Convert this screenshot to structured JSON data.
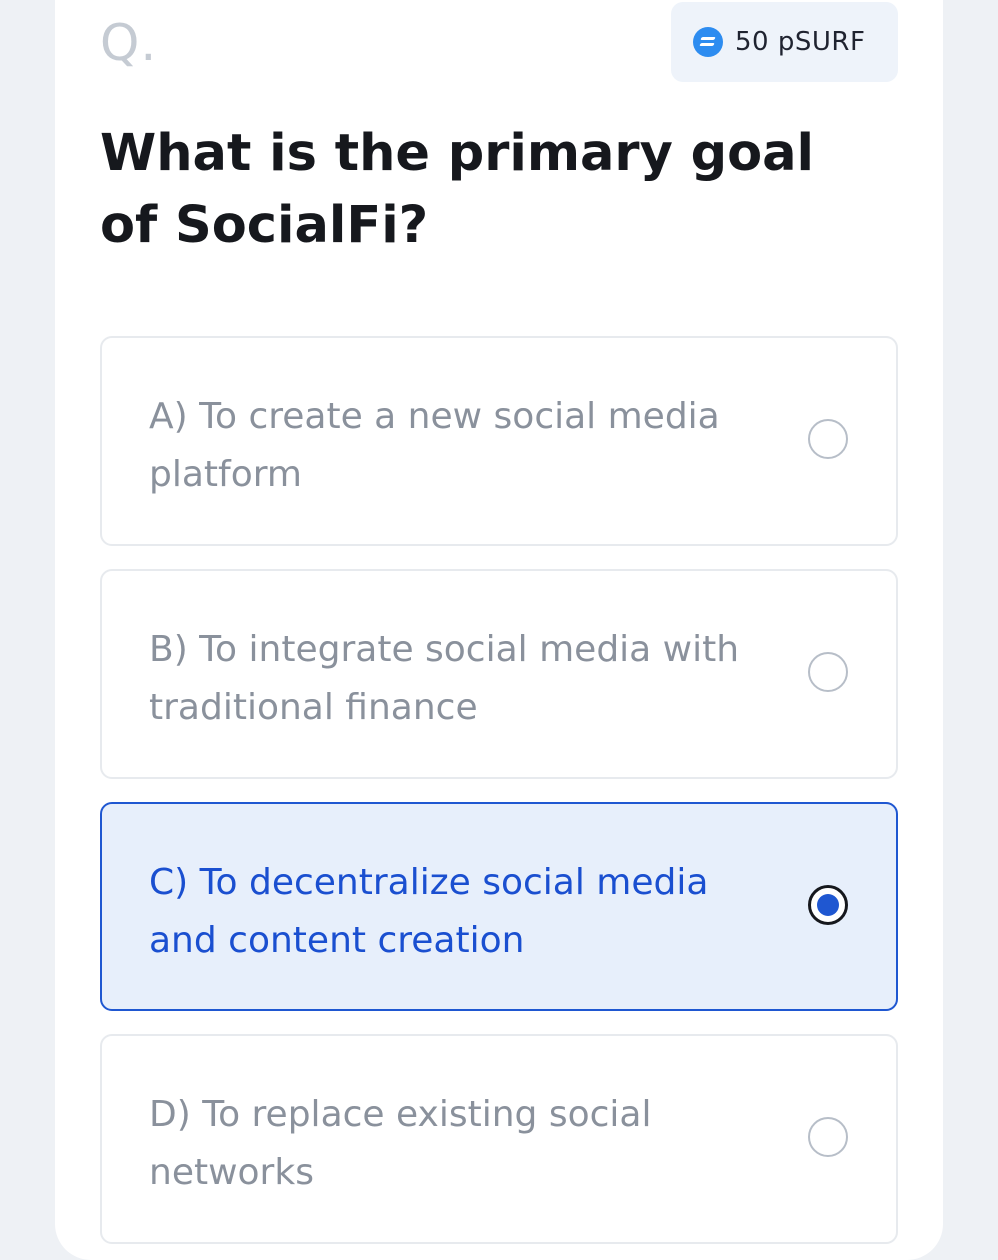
{
  "header": {
    "q_marker": "Q.",
    "reward": {
      "icon": "coin-icon",
      "amount": "50 pSURF"
    }
  },
  "question": {
    "text": "What is the primary goal of SocialFi?"
  },
  "options": [
    {
      "label": "A) To create a new social media platform",
      "selected": false
    },
    {
      "label": "B) To integrate social media with traditional finance",
      "selected": false
    },
    {
      "label": "C) To decentralize social media and content creation",
      "selected": true
    },
    {
      "label": "D) To replace existing social networks",
      "selected": false
    }
  ],
  "colors": {
    "accent": "#1f57d1",
    "selected_bg": "#e7effb",
    "option_text": "#8a919c",
    "coin": "#2d8cf0"
  }
}
